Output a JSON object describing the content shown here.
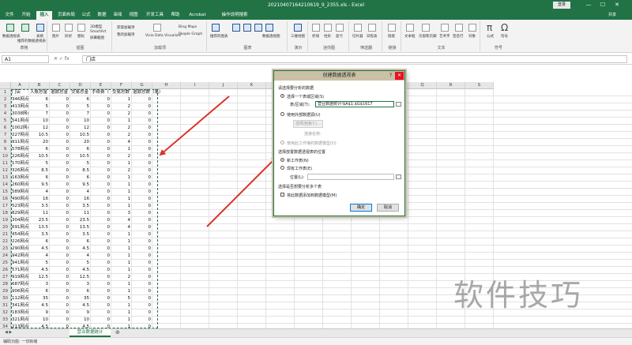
{
  "window": {
    "title": "20210407164210619_9_2355.xls - Excel",
    "signin_label": "登录",
    "controls": [
      "—",
      "☐",
      "✕"
    ]
  },
  "menu": {
    "tabs": [
      "文件",
      "开始",
      "插入",
      "页面布局",
      "公式",
      "数据",
      "审阅",
      "视图",
      "开发工具",
      "帮助",
      "Acrobat",
      "操作说明搜索"
    ],
    "active": "插入",
    "share_label": "共享"
  },
  "ribbon": {
    "groups": [
      {
        "label": "表格",
        "items": [
          "数据透视表",
          "推荐的数据透视表",
          "表格"
        ]
      },
      {
        "label": "插图",
        "items": [
          "图片",
          "形状",
          "图标",
          "3D模型",
          "SmartArt",
          "屏幕截图"
        ]
      },
      {
        "label": "加载项",
        "items": [
          "获取加载项",
          "我的加载项",
          "Visio Data Visualizer",
          "Bing Maps",
          "People Graph"
        ]
      },
      {
        "label": "图表",
        "items": [
          "推荐的图表",
          "数据透视图"
        ]
      },
      {
        "label": "演示",
        "items": [
          "三维地图"
        ]
      },
      {
        "label": "迷你图",
        "items": [
          "折线",
          "柱形",
          "盈亏"
        ]
      },
      {
        "label": "筛选器",
        "items": [
          "切片器",
          "日程表"
        ]
      },
      {
        "label": "链接",
        "items": [
          "链接"
        ]
      },
      {
        "label": "文本",
        "items": [
          "文本框",
          "页眉和页脚",
          "艺术字",
          "签名行",
          "对象"
        ]
      },
      {
        "label": "符号",
        "items": [
          "公式",
          "符号"
        ]
      }
    ]
  },
  "formula_bar": {
    "name_box": "A1",
    "fx": "✕  ✓  fx",
    "content": "门店"
  },
  "grid": {
    "columns": [
      "A",
      "B",
      "C",
      "D",
      "E",
      "F",
      "G",
      "H",
      "I",
      "J",
      "K",
      "L",
      "M",
      "N",
      "O",
      "P",
      "Q",
      "R",
      "S"
    ],
    "headers": [
      "门店",
      "入账总金",
      "退款总金",
      "交易总金",
      "手续费（",
      "交易总数",
      "退款总数（笔）",
      ""
    ],
    "rows": [
      [
        "346网点",
        "6",
        "0",
        "6",
        "0",
        "1",
        "0"
      ],
      [
        "413网点",
        "5",
        "0",
        "5",
        "0",
        "2",
        "0"
      ],
      [
        "3038网点",
        "7",
        "0",
        "7",
        "0",
        "2",
        "0"
      ],
      [
        "541网点",
        "10",
        "0",
        "10",
        "0",
        "1",
        "0"
      ],
      [
        "1002网点",
        "12",
        "0",
        "12",
        "0",
        "2",
        "0"
      ],
      [
        "227网点",
        "10.5",
        "0",
        "10.5",
        "0",
        "2",
        "0"
      ],
      [
        "911网点",
        "20",
        "0",
        "20",
        "0",
        "4",
        "0"
      ],
      [
        "578网点",
        "6",
        "0",
        "6",
        "0",
        "1",
        "0"
      ],
      [
        "226网点",
        "10.5",
        "0",
        "10.5",
        "0",
        "2",
        "0"
      ],
      [
        "170网点",
        "5",
        "0",
        "5",
        "0",
        "1",
        "0"
      ],
      [
        "326网点",
        "8.5",
        "0",
        "8.5",
        "0",
        "2",
        "0"
      ],
      [
        "163网点",
        "6",
        "0",
        "6",
        "0",
        "1",
        "0"
      ],
      [
        "260网点",
        "9.5",
        "0",
        "9.5",
        "0",
        "1",
        "0"
      ],
      [
        "589网点",
        "4",
        "0",
        "4",
        "0",
        "1",
        "0"
      ],
      [
        "490网点",
        "16",
        "0",
        "16",
        "0",
        "1",
        "0"
      ],
      [
        "523网点",
        "3.5",
        "0",
        "3.5",
        "0",
        "1",
        "0"
      ],
      [
        "829网点",
        "11",
        "0",
        "11",
        "0",
        "3",
        "0"
      ],
      [
        "304网点",
        "23.5",
        "0",
        "23.5",
        "0",
        "4",
        "0"
      ],
      [
        "691网点",
        "13.5",
        "0",
        "13.5",
        "0",
        "4",
        "0"
      ],
      [
        "454网点",
        "3.5",
        "0",
        "3.5",
        "0",
        "1",
        "0"
      ],
      [
        "226网点",
        "6",
        "0",
        "6",
        "0",
        "1",
        "0"
      ],
      [
        "290网点",
        "4.5",
        "0",
        "4.5",
        "0",
        "1",
        "0"
      ],
      [
        "942网点",
        "4",
        "0",
        "4",
        "0",
        "1",
        "0"
      ],
      [
        "941网点",
        "5",
        "0",
        "5",
        "0",
        "1",
        "0"
      ],
      [
        "571网点",
        "4.5",
        "0",
        "4.5",
        "0",
        "1",
        "0"
      ],
      [
        "919网点",
        "12.5",
        "0",
        "12.5",
        "0",
        "2",
        "0"
      ],
      [
        "687网点",
        "3",
        "0",
        "3",
        "0",
        "1",
        "0"
      ],
      [
        "906网点",
        "6",
        "0",
        "6",
        "0",
        "1",
        "0"
      ],
      [
        "112网点",
        "35",
        "0",
        "35",
        "0",
        "5",
        "0"
      ],
      [
        "341网点",
        "4.5",
        "0",
        "4.5",
        "0",
        "1",
        "0"
      ],
      [
        "183网点",
        "9",
        "0",
        "9",
        "0",
        "1",
        "0"
      ],
      [
        "321网点",
        "10",
        "0",
        "10",
        "0",
        "1",
        "0"
      ],
      [
        "213网点",
        "4.5",
        "0",
        "4.5",
        "0",
        "1",
        "0"
      ],
      [
        "929网点",
        "8",
        "0",
        "8",
        "0",
        "1",
        "0"
      ],
      [
        "362网点",
        "12.5",
        "0",
        "12.5",
        "0",
        "2",
        "0"
      ]
    ]
  },
  "sheets": {
    "nav": "◀  ▶",
    "active": "营业数据统计",
    "add": "⊕"
  },
  "status": "辅助功能: 一切就绪",
  "dialog": {
    "title": "创建数据透视表",
    "help": "?",
    "close": "✕",
    "section1": "请选择要分析的数据",
    "opt_table": "选择一个表或区域(S)",
    "range_label": "表/区域(T):",
    "range_value": "营业数据统计!$A$1:$G$1617",
    "opt_external": "使用外部数据源(U)",
    "choose_conn": "选择连接(C)...",
    "conn_name": "连接名称:",
    "opt_model": "使用此工作簿的数据模型(D)",
    "section2": "选择放置数据透视表的位置",
    "opt_new_sheet": "新工作表(N)",
    "opt_existing": "现有工作表(E)",
    "location_label": "位置(L):",
    "section3": "选择是否想要分析多个表",
    "chk_model": "将此数据添加到数据模型(M)",
    "ok": "确定",
    "cancel": "取消"
  },
  "watermark": "软件技巧",
  "colors": {
    "excel_green": "#217346",
    "arrow_red": "#d9342b",
    "dialog_title": "#c9c0a6"
  }
}
